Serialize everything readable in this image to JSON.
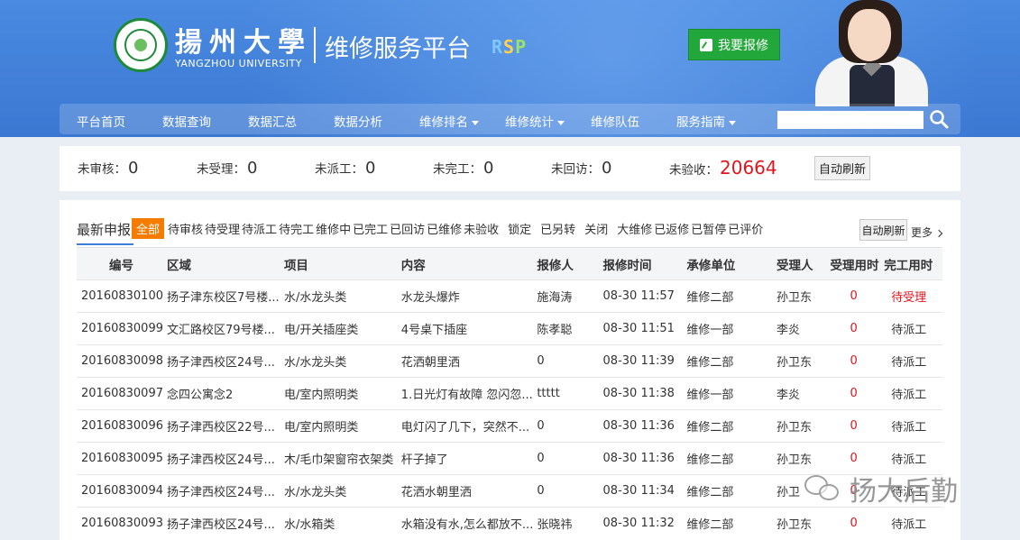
{
  "header": {
    "univ_cn": "揚州大學",
    "univ_en": "YANGZHOU UNIVERSITY",
    "platform_title": "维修服务平台",
    "platform_tag": {
      "r": "R",
      "s": "S",
      "p": "P"
    },
    "report_button": "我要报修"
  },
  "nav": {
    "items": [
      {
        "label": "平台首页",
        "dropdown": false
      },
      {
        "label": "数据查询",
        "dropdown": false
      },
      {
        "label": "数据汇总",
        "dropdown": false
      },
      {
        "label": "数据分析",
        "dropdown": false
      },
      {
        "label": "维修排名",
        "dropdown": true
      },
      {
        "label": "维修统计",
        "dropdown": true
      },
      {
        "label": "维修队伍",
        "dropdown": false
      },
      {
        "label": "服务指南",
        "dropdown": true
      }
    ],
    "search_value": ""
  },
  "stats": {
    "items": [
      {
        "label": "未审核：",
        "value": "0"
      },
      {
        "label": "未受理：",
        "value": "0"
      },
      {
        "label": "未派工：",
        "value": "0"
      },
      {
        "label": "未完工：",
        "value": "0"
      },
      {
        "label": "未回访：",
        "value": "0"
      },
      {
        "label": "未验收：",
        "value": "20664"
      }
    ],
    "refresh_label": "自动刷新"
  },
  "panel": {
    "title": "最新申报",
    "filters": [
      "全部",
      "待审核",
      "待受理",
      "待派工",
      "待完工",
      "维修中",
      "已完工",
      "已回访",
      "已维修",
      "未验收",
      "锁定",
      "已另转",
      "关闭",
      "大维修",
      "已返修",
      "已暂停",
      "已评价"
    ],
    "active_filter": "全部",
    "refresh_label": "自动刷新",
    "more_label": "更多",
    "columns": [
      "编号",
      "区域",
      "项目",
      "内容",
      "报修人",
      "报修时间",
      "承修单位",
      "受理人",
      "受理用时",
      "完工用时"
    ],
    "rows": [
      [
        "20160830100",
        "扬子津东校区7号楼...",
        "水/水龙头类",
        "水龙头爆炸",
        "施海涛",
        "08-30 11:57",
        "维修二部",
        "孙卫东",
        "0",
        "待受理"
      ],
      [
        "20160830099",
        "文汇路校区79号楼...",
        "电/开关插座类",
        "4号桌下插座",
        "陈孝聪",
        "08-30 11:51",
        "维修一部",
        "李炎",
        "0",
        "待派工"
      ],
      [
        "20160830098",
        "扬子津西校区24号...",
        "水/水龙头类",
        "花洒朝里洒",
        "0",
        "08-30 11:39",
        "维修二部",
        "孙卫东",
        "0",
        "待派工"
      ],
      [
        "20160830097",
        "念四公寓念2",
        "电/室内照明类",
        "1.日光灯有故障 忽闪忽...",
        "ttttt",
        "08-30 11:38",
        "维修一部",
        "李炎",
        "0",
        "待派工"
      ],
      [
        "20160830096",
        "扬子津西校区22号...",
        "电/室内照明类",
        "电灯闪了几下，突然不...",
        "0",
        "08-30 11:36",
        "维修二部",
        "孙卫东",
        "0",
        "待派工"
      ],
      [
        "20160830095",
        "扬子津西校区24号...",
        "木/毛巾架窗帘衣架类",
        "杆子掉了",
        "0",
        "08-30 11:36",
        "维修二部",
        "孙卫东",
        "0",
        "待派工"
      ],
      [
        "20160830094",
        "扬子津西校区24号...",
        "水/水龙头类",
        "花洒水朝里洒",
        "0",
        "08-30 11:34",
        "维修二部",
        "孙卫",
        "0",
        "待派工"
      ],
      [
        "20160830093",
        "扬子津西校区24号...",
        "水/水箱类",
        "水箱没有水,怎么都放不...",
        "张晓祎",
        "08-30 11:32",
        "维修二部",
        "孙卫东",
        "0",
        "待派工"
      ]
    ]
  },
  "watermark": "扬大后勤",
  "colors": {
    "header_blue": "#3d7fd8",
    "accent_orange": "#f57c00",
    "status_red": "#e0141e",
    "button_green": "#22a83a"
  }
}
